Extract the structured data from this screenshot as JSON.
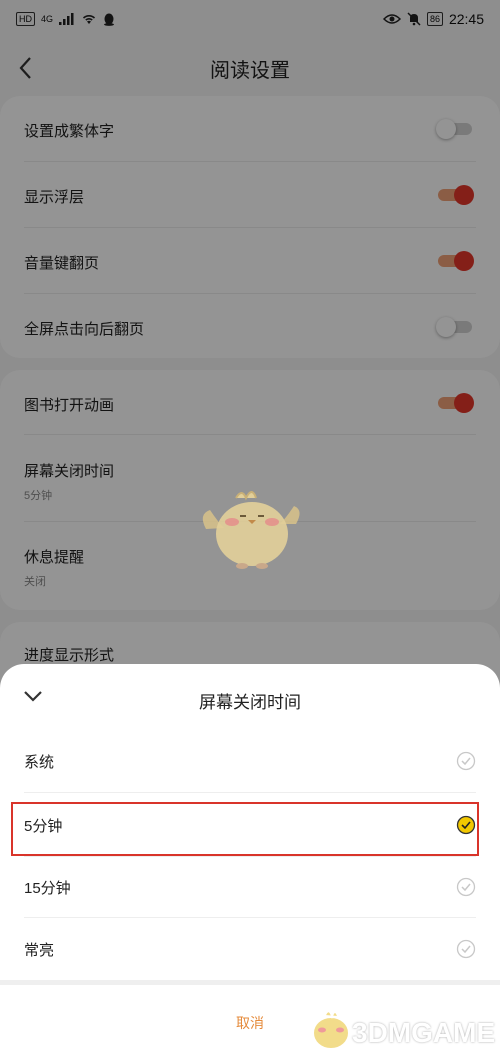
{
  "status_bar": {
    "left_tags": [
      "HD",
      "4G"
    ],
    "battery": "86",
    "time": "22:45"
  },
  "header": {
    "title": "阅读设置"
  },
  "settings": {
    "group1": [
      {
        "label": "设置成繁体字",
        "toggle": "off"
      },
      {
        "label": "显示浮层",
        "toggle": "on"
      },
      {
        "label": "音量键翻页",
        "toggle": "on"
      },
      {
        "label": "全屏点击向后翻页",
        "toggle": "off"
      }
    ],
    "group2": [
      {
        "label": "图书打开动画",
        "toggle": "on"
      },
      {
        "label": "屏幕关闭时间",
        "sub": "5分钟"
      },
      {
        "label": "休息提醒",
        "sub": "关闭"
      },
      {
        "label": "进度显示形式"
      }
    ]
  },
  "sheet": {
    "title": "屏幕关闭时间",
    "options": [
      {
        "label": "系统",
        "selected": false
      },
      {
        "label": "5分钟",
        "selected": true
      },
      {
        "label": "15分钟",
        "selected": false
      },
      {
        "label": "常亮",
        "selected": false
      }
    ],
    "cancel": "取消"
  },
  "watermark": {
    "text": "3DMGAME"
  },
  "colors": {
    "accent": "#e4362a",
    "toggle_track_on": "#f0a078",
    "cancel": "#e58a3a",
    "selected_check": "#f2c800",
    "highlight": "#d9342a"
  }
}
